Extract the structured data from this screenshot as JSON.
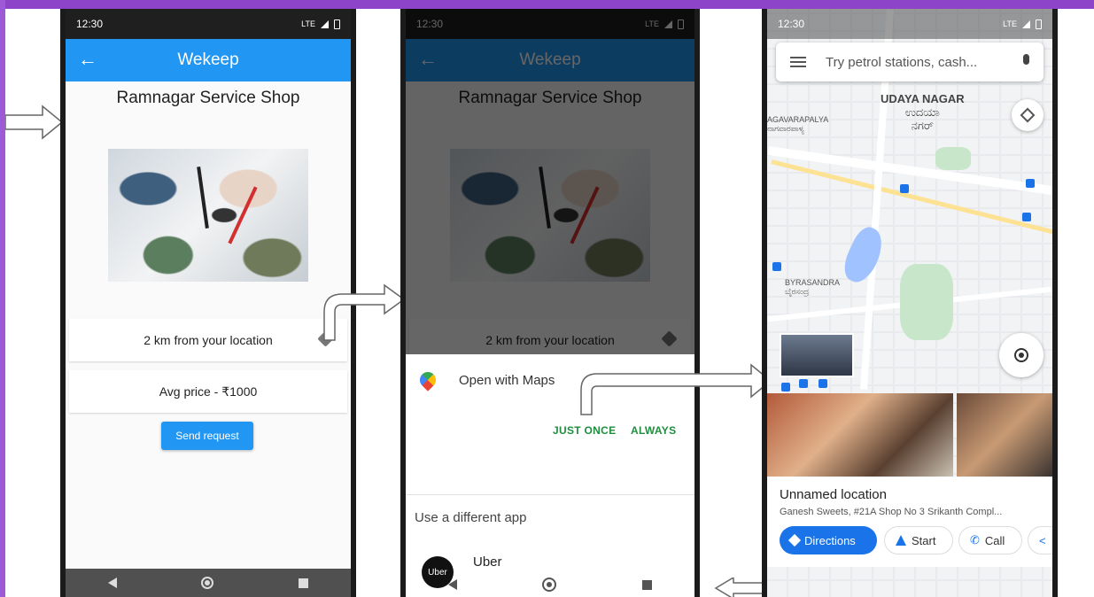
{
  "status": {
    "time": "12:30",
    "lte": "LTE"
  },
  "app": {
    "title": "Wekeep",
    "back": "←"
  },
  "shop": {
    "name": "Ramnagar Service Shop",
    "distance": "2 km from your location",
    "price": "Avg price  - ₹1000",
    "send_label": "Send request"
  },
  "chooser": {
    "title": "Open with Maps",
    "just_once": "JUST ONCE",
    "always": "ALWAYS",
    "different_app": "Use a different app",
    "uber": "Uber",
    "uber_icon": "Uber"
  },
  "maps": {
    "search_placeholder": "Try petrol stations, cash...",
    "area_main_en": "UDAYA NAGAR",
    "area_main_kn": "ಉದಯಾ",
    "area_main_kn2": "ನಗರ್",
    "area_left": "AGAVARAPALYA",
    "area_left_kn": "ನಾಗವಾರಪಾಳ್ಯ",
    "area_byr": "BYRASANDRA",
    "area_byr_kn": "ಬೈರಸಂದ್ರ",
    "place_title": "Unnamed location",
    "place_addr": "Ganesh Sweets, #21A Shop No 3 Srikanth Compl...",
    "directions": "Directions",
    "start": "Start",
    "call": "Call"
  },
  "colors": {
    "appbar": "#2196f3",
    "accent_green": "#1e8e3e",
    "maps_blue": "#1a73e8"
  }
}
